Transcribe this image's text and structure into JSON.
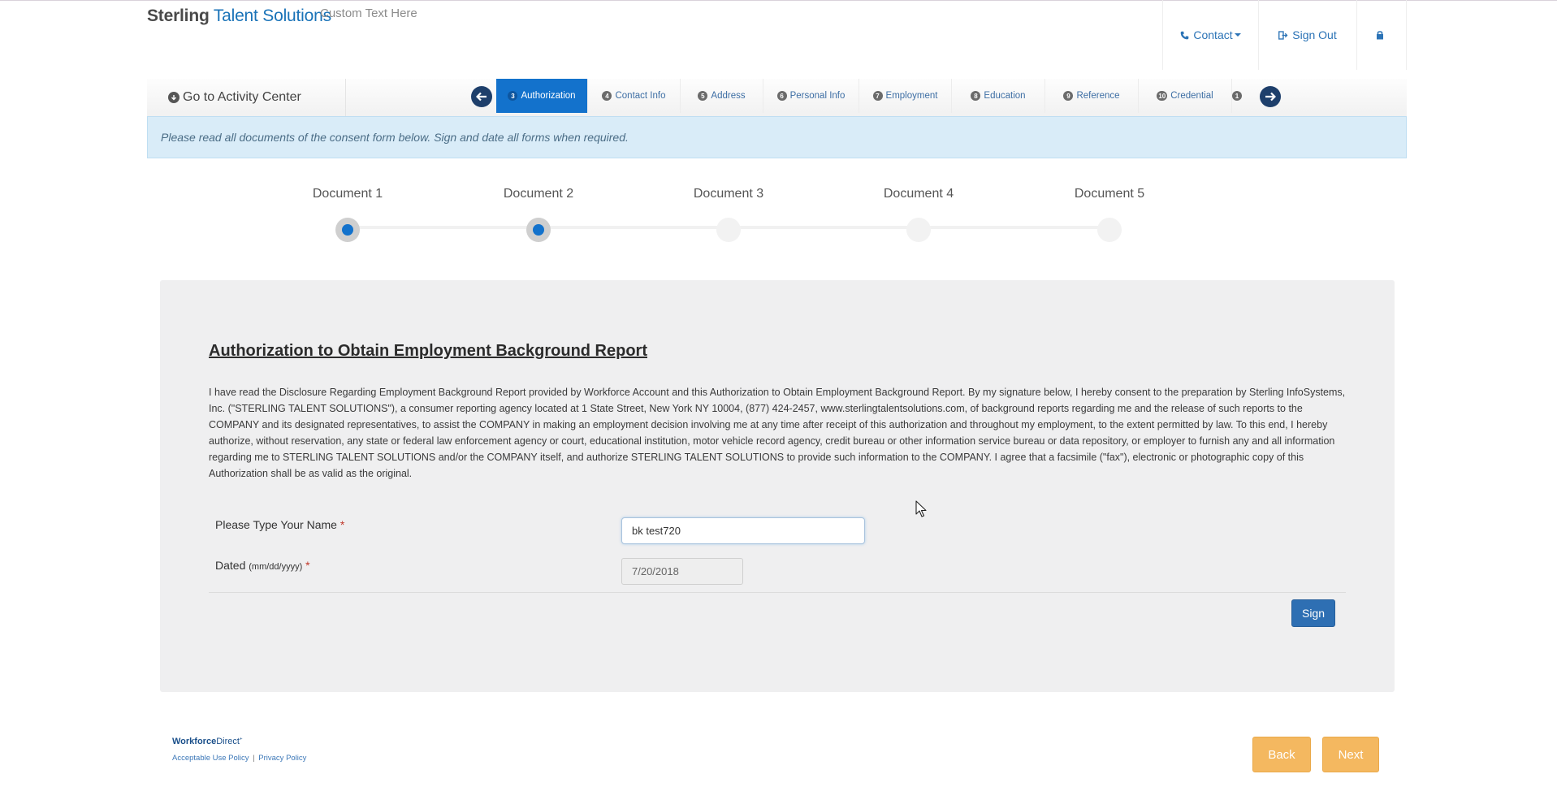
{
  "header": {
    "brand_part1": "Sterling",
    "brand_part2": " Talent Solutions",
    "custom_text": "Custom Text Here",
    "contact_label": "Contact",
    "signout_label": "Sign Out",
    "accent_color": "#1372cc"
  },
  "nav": {
    "activity_center_label": "Go to Activity Center",
    "steps": [
      {
        "num": "3",
        "label": "Authorization",
        "active": true
      },
      {
        "num": "4",
        "label": "Contact Info"
      },
      {
        "num": "5",
        "label": "Address"
      },
      {
        "num": "6",
        "label": "Personal Info"
      },
      {
        "num": "7",
        "label": "Employment"
      },
      {
        "num": "8",
        "label": "Education"
      },
      {
        "num": "9",
        "label": "Reference"
      },
      {
        "num": "10",
        "label": "Credential"
      },
      {
        "num": "1",
        "label": ""
      }
    ]
  },
  "alert": {
    "text": "Please read all documents of the consent form below. Sign and date all forms when required."
  },
  "documents": [
    {
      "label": "Document 1",
      "completed": true
    },
    {
      "label": "Document 2",
      "completed": true
    },
    {
      "label": "Document 3",
      "completed": false
    },
    {
      "label": "Document 4",
      "completed": false
    },
    {
      "label": "Document 5",
      "completed": false
    }
  ],
  "form": {
    "title": "Authorization to Obtain Employment Background Report",
    "body": "I have read the Disclosure Regarding Employment Background Report provided by Workforce Account and this Authorization to Obtain Employment Background Report. By my signature below, I hereby consent to the preparation by Sterling InfoSystems, Inc. (\"STERLING TALENT SOLUTIONS\"), a consumer reporting agency located at 1 State Street, New York NY 10004, (877) 424-2457, www.sterlingtalentsolutions.com, of background reports regarding me and the release of such reports to the COMPANY and its designated representatives, to assist the COMPANY in making an employment decision involving me at any time after receipt of this authorization and throughout my employment, to the extent permitted by law. To this end, I hereby authorize, without reservation, any state or federal law enforcement agency or court, educational institution, motor vehicle record agency, credit bureau or other information service bureau or data repository, or employer to furnish any and all information regarding me to STERLING TALENT SOLUTIONS and/or the COMPANY itself, and authorize STERLING TALENT SOLUTIONS to provide such information to the COMPANY. I agree that a facsimile (\"fax\"), electronic or photographic copy of this Authorization shall be as valid as the original.",
    "name_label": "Please Type Your Name",
    "name_value": "bk test720",
    "date_label": "Dated",
    "date_hint": "(mm/dd/yyyy)",
    "date_value": "7/20/2018",
    "required_marker": "*",
    "sign_label": "Sign"
  },
  "footer": {
    "logo_part1": "Workforce",
    "logo_part2": "Direct",
    "logo_tm": "+",
    "acceptable_use_label": "Acceptable Use Policy",
    "separator": "|",
    "privacy_label": "Privacy Policy",
    "back_label": "Back",
    "next_label": "Next"
  }
}
